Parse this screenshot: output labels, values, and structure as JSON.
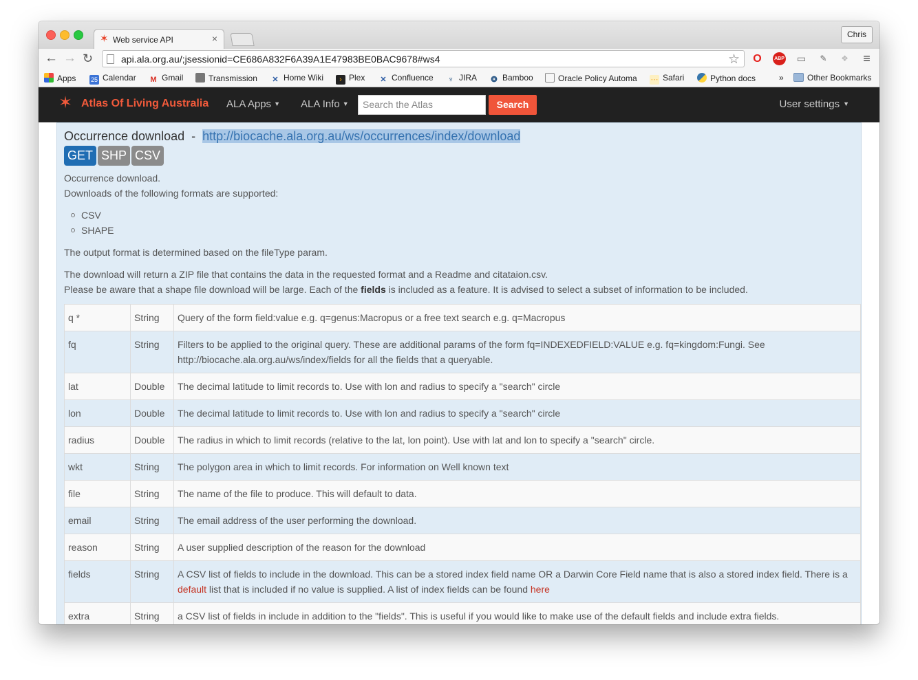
{
  "browser": {
    "tab_title": "Web service API",
    "tab_close": "×",
    "profile_name": "Chris",
    "url": "api.ala.org.au/;jsessionid=CE686A832F6A39A1E47983BE0BAC9678#ws4",
    "bookmarks": [
      {
        "label": "Apps",
        "icon": "apps-grid-icon",
        "color": "#e44"
      },
      {
        "label": "Calendar",
        "icon": "calendar-icon",
        "color": "#3b73d6",
        "glyph": "25"
      },
      {
        "label": "Gmail",
        "icon": "gmail-icon",
        "color": "#d93025",
        "glyph": "M"
      },
      {
        "label": "Transmission",
        "icon": "transmission-icon",
        "color": "#777"
      },
      {
        "label": "Home Wiki",
        "icon": "confluence-icon",
        "color": "#2a5aa3"
      },
      {
        "label": "Plex",
        "icon": "plex-icon",
        "color": "#e5a00d"
      },
      {
        "label": "Confluence",
        "icon": "confluence-icon",
        "color": "#2a5aa3"
      },
      {
        "label": "JIRA",
        "icon": "jira-icon",
        "color": "#205081"
      },
      {
        "label": "Bamboo",
        "icon": "bamboo-icon",
        "color": "#205081"
      },
      {
        "label": "Oracle Policy Automa",
        "icon": "oracle-icon",
        "color": "#888"
      },
      {
        "label": "Safari",
        "icon": "safari-icon",
        "color": "#f5a623"
      },
      {
        "label": "Python docs",
        "icon": "python-icon",
        "color": "#3776ab"
      }
    ],
    "bookmarks_overflow": "»",
    "other_bookmarks": "Other Bookmarks"
  },
  "site": {
    "name": "Atlas Of Living Australia",
    "menu_apps": "ALA Apps",
    "menu_info": "ALA Info",
    "search_placeholder": "Search the Atlas",
    "search_button": "Search",
    "user_settings": "User settings",
    "accent_color": "#f15a3b"
  },
  "endpoint": {
    "title": "Occurrence download",
    "separator": "-",
    "url": "http://biocache.ala.org.au/ws/occurrences/index/download",
    "badges": [
      "GET",
      "SHP",
      "CSV"
    ],
    "intro_1": "Occurrence download.",
    "intro_2": "Downloads of the following formats are supported:",
    "formats": [
      "CSV",
      "SHAPE"
    ],
    "output_note": "The output format is determined based on the fileType param.",
    "zip_note": "The download will return a ZIP file that contains the data in the requested format and a Readme and citataion.csv.",
    "shape_note_before": "Please be aware that a shape file download will be large. Each of the ",
    "shape_note_bold": "fields",
    "shape_note_after": " is included as a feature. It is advised to select a subset of information to be included."
  },
  "params": [
    {
      "name": "q *",
      "type": "String",
      "desc": "Query of the form field:value e.g. q=genus:Macropus or a free text search e.g. q=Macropus"
    },
    {
      "name": "fq",
      "type": "String",
      "desc": "Filters to be applied to the original query. These are additional params of the form fq=INDEXEDFIELD:VALUE e.g. fq=kingdom:Fungi. See http://biocache.ala.org.au/ws/index/fields for all the fields that a queryable."
    },
    {
      "name": "lat",
      "type": "Double",
      "desc": "The decimal latitude to limit records to. Use with lon and radius to specify a \"search\" circle"
    },
    {
      "name": "lon",
      "type": "Double",
      "desc": "The decimal latitude to limit records to. Use with lon and radius to specify a \"search\" circle"
    },
    {
      "name": "radius",
      "type": "Double",
      "desc": "The radius in which to limit records (relative to the lat, lon point). Use with lat and lon to specify a \"search\" circle."
    },
    {
      "name": "wkt",
      "type": "String",
      "desc": "The polygon area in which to limit records. For information on Well known text"
    },
    {
      "name": "file",
      "type": "String",
      "desc": "The name of the file to produce. This will default to data."
    },
    {
      "name": "email",
      "type": "String",
      "desc": "The email address of the user performing the download."
    },
    {
      "name": "reason",
      "type": "String",
      "desc": "A user supplied description of the reason for the download"
    }
  ],
  "fields_row": {
    "name": "fields",
    "type": "String",
    "desc_1": "A CSV list of fields to include in the download. This can be a stored index field name OR a Darwin Core Field name that is also a stored index field. There is a",
    "link_default": "default",
    "desc_2": " list that is included if no value is supplied. A list of index fields can be found ",
    "link_here": "here"
  },
  "extra_row": {
    "name": "extra",
    "type": "String",
    "desc": "a CSV list of fields in include in addition to the \"fields\". This is useful if you would like to make use of the default fields and include extra fields."
  }
}
